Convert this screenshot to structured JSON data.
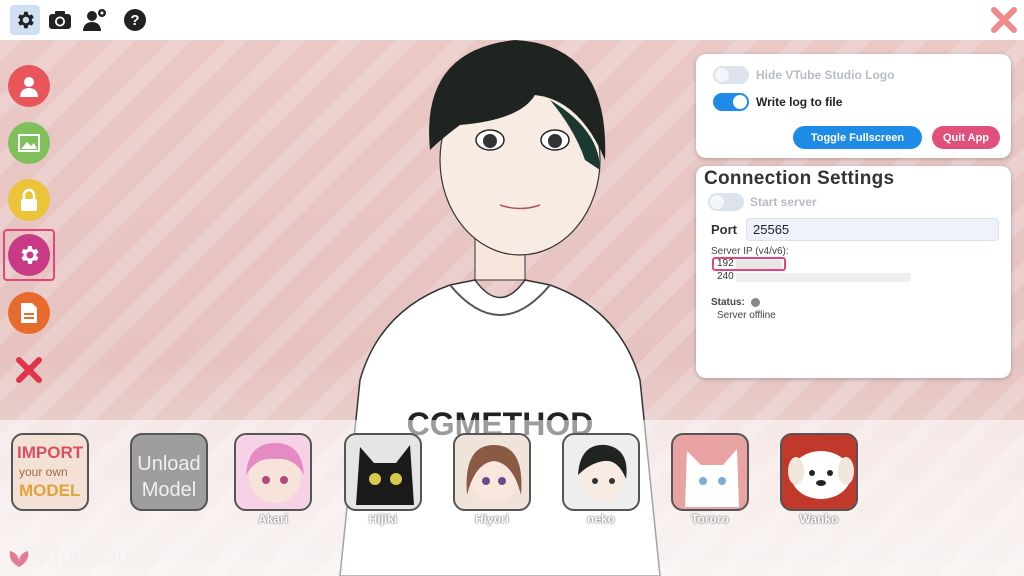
{
  "toolbar": {
    "icons": [
      "gear-icon",
      "camera-icon",
      "user-settings-icon",
      "help-icon"
    ],
    "close_icon": "close-icon"
  },
  "sidebar": {
    "items": [
      {
        "name": "avatar-icon",
        "color": "#e8555a"
      },
      {
        "name": "background-icon",
        "color": "#7fc05a"
      },
      {
        "name": "lock-icon",
        "color": "#ecc43a"
      },
      {
        "name": "settings-icon",
        "color": "#c93a86"
      },
      {
        "name": "log-icon",
        "color": "#e86a2c"
      },
      {
        "name": "close-icon",
        "color": "#e0344a"
      }
    ]
  },
  "settings_panel": {
    "hide_logo_label": "Hide VTube Studio Logo",
    "hide_logo_on": false,
    "write_log_label": "Write log to file",
    "write_log_on": true,
    "toggle_fullscreen_label": "Toggle Fullscreen",
    "quit_app_label": "Quit App"
  },
  "connection": {
    "title": "Connection Settings",
    "start_server_label": "Start server",
    "start_server_on": false,
    "port_label": "Port",
    "port_value": "25565",
    "server_ip_label": "Server IP (v4/v6):",
    "ipv4": "192",
    "ipv6": "240",
    "status_label": "Status:",
    "status_text": "Server offline"
  },
  "character": {
    "shirt_text": "CGMETHOD"
  },
  "models": [
    {
      "label": "",
      "title": [
        "IMPORT",
        "your own",
        "MODEL"
      ]
    },
    {
      "label": "",
      "title": [
        "Unload",
        "Model"
      ]
    },
    {
      "label": "Akari"
    },
    {
      "label": "Hijiki"
    },
    {
      "label": "Hiyori"
    },
    {
      "label": "neko"
    },
    {
      "label": "Tororo"
    },
    {
      "label": "Wanko"
    }
  ],
  "brand": {
    "logo_text": "VTubeStudio"
  },
  "colors": {
    "accent_blue": "#1e8be6",
    "quit_pink": "#e0507a",
    "highlight_pink": "#e8427a"
  }
}
